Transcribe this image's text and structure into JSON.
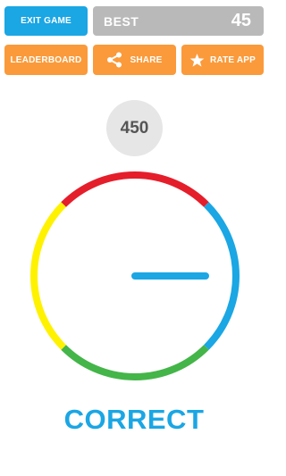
{
  "colors": {
    "blue": "#1ba6e4",
    "orange": "#fb9a3a",
    "grey": "#b9b9b9",
    "score_bg": "#e6e6e6",
    "red": "#e51e2b",
    "yellow": "#fff200",
    "green": "#44b549"
  },
  "top_bar": {
    "exit_label": "EXIT GAME",
    "best_label": "BEST",
    "best_value": "45"
  },
  "action_bar": {
    "leaderboard_label": "LEADERBOARD",
    "share_label": "SHARE",
    "share_icon": "share-icon",
    "rate_label": "RATE APP",
    "rate_icon": "star-icon"
  },
  "game": {
    "score": "450",
    "status": "CORRECT",
    "ring_segments": [
      "red",
      "blue",
      "green",
      "yellow"
    ],
    "pointer_color": "blue"
  }
}
